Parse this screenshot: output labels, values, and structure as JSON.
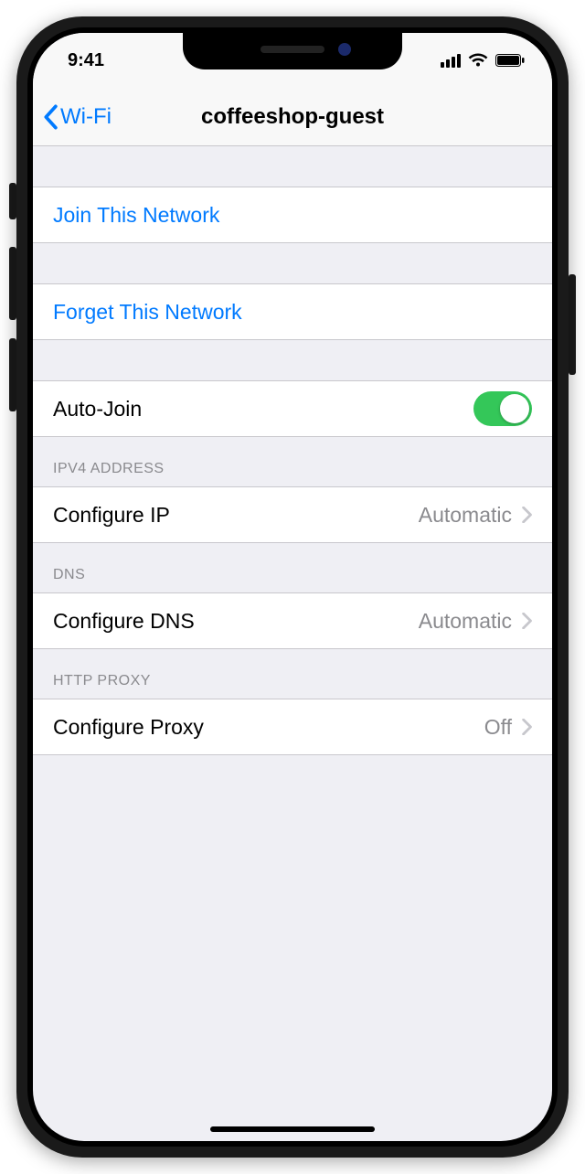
{
  "status": {
    "time": "9:41"
  },
  "nav": {
    "back_label": "Wi-Fi",
    "title": "coffeeshop-guest"
  },
  "actions": {
    "join_label": "Join This Network",
    "forget_label": "Forget This Network"
  },
  "auto_join": {
    "label": "Auto-Join",
    "on": true
  },
  "ipv4": {
    "header": "IPV4 ADDRESS",
    "configure_ip_label": "Configure IP",
    "configure_ip_value": "Automatic"
  },
  "dns": {
    "header": "DNS",
    "configure_dns_label": "Configure DNS",
    "configure_dns_value": "Automatic"
  },
  "proxy": {
    "header": "HTTP PROXY",
    "configure_proxy_label": "Configure Proxy",
    "configure_proxy_value": "Off"
  }
}
